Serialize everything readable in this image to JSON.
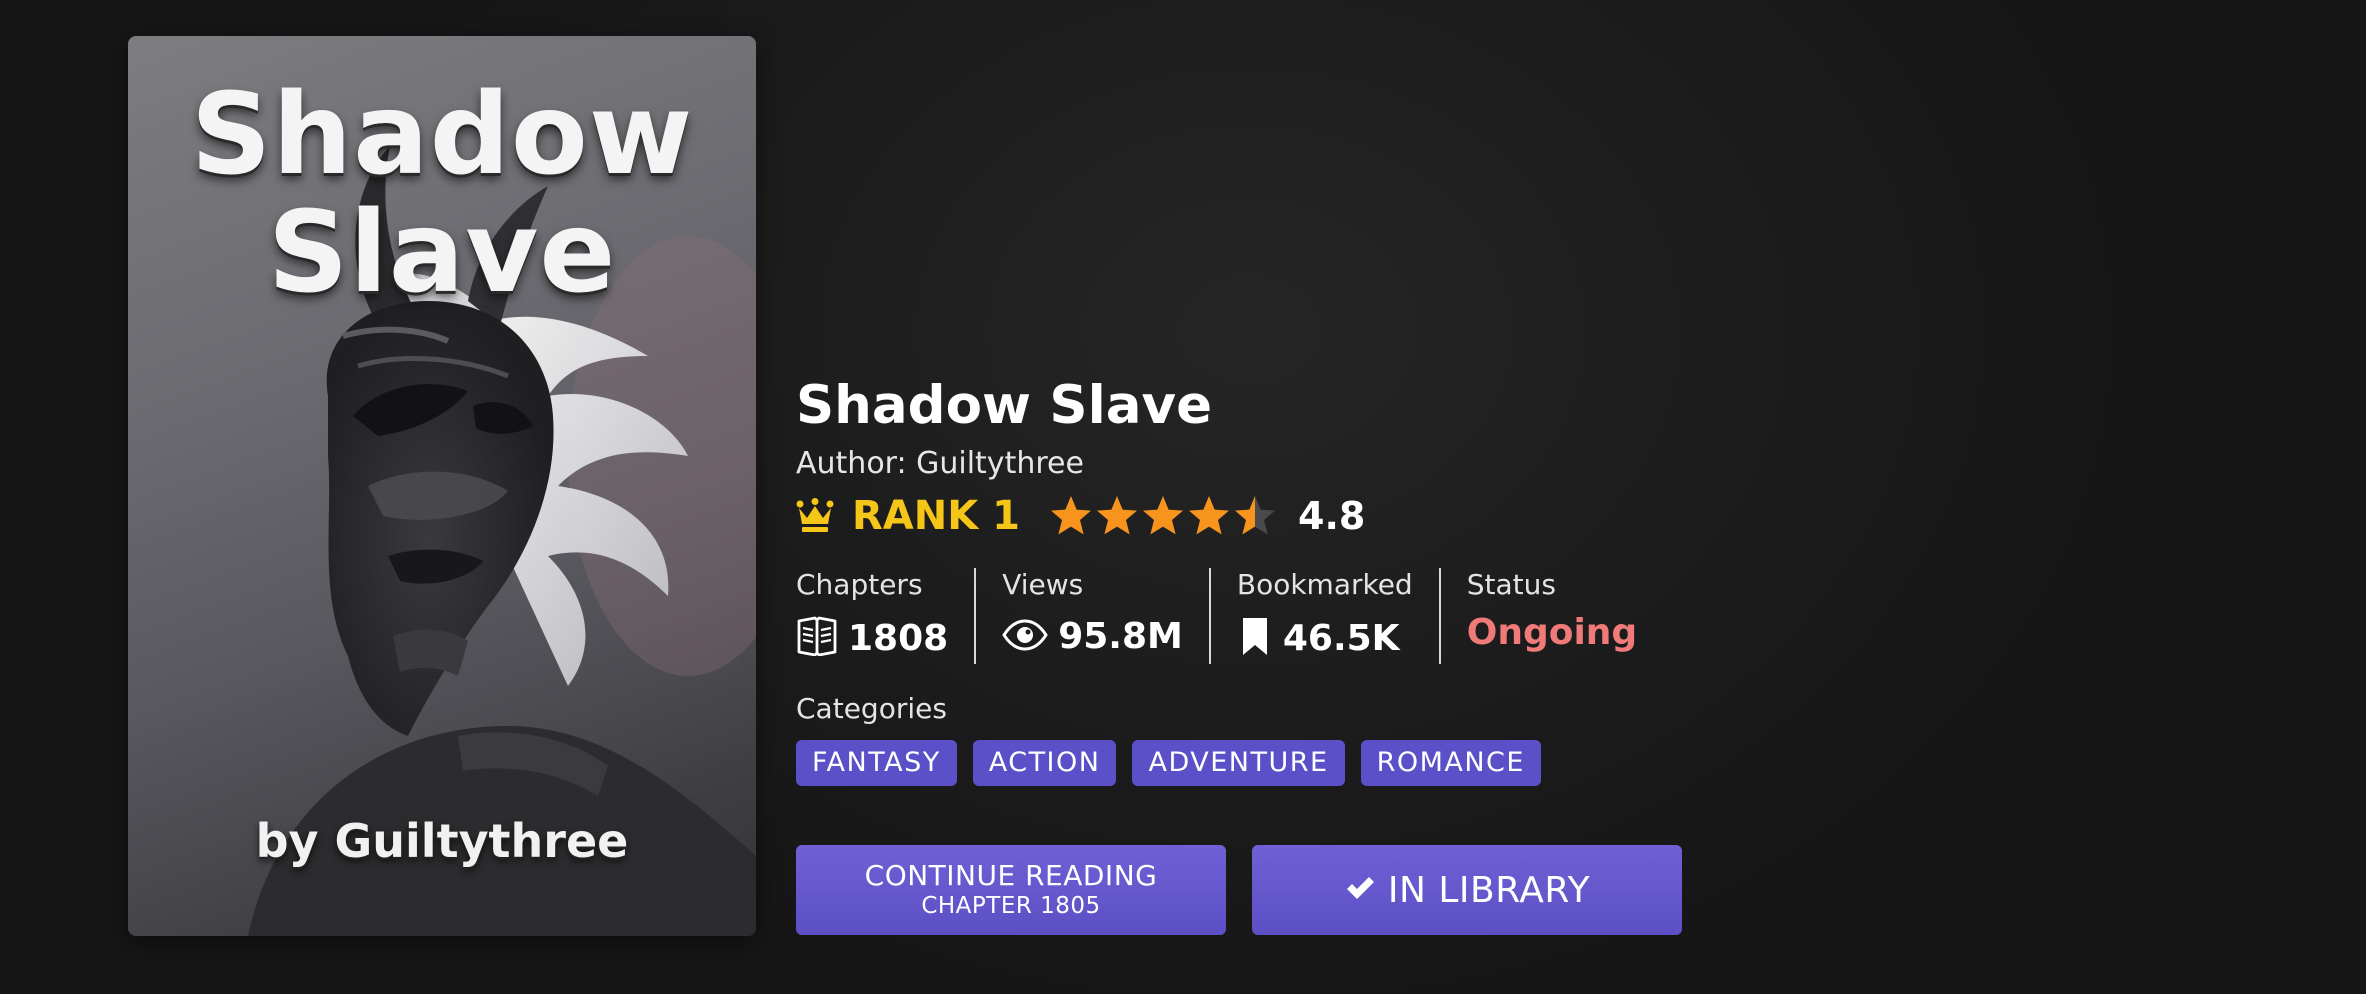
{
  "cover": {
    "title": "Shadow Slave",
    "byline": "by Guiltythree"
  },
  "novel": {
    "title": "Shadow Slave",
    "author": "Author: Guiltythree",
    "rank": "RANK 1",
    "rating": {
      "value": "4.8",
      "stars": 4.5,
      "max_stars": 5
    }
  },
  "stats": {
    "chapters": {
      "label": "Chapters",
      "value": "1808",
      "icon": "book-icon"
    },
    "views": {
      "label": "Views",
      "value": "95.8M",
      "icon": "eye-icon"
    },
    "bookmarked": {
      "label": "Bookmarked",
      "value": "46.5K",
      "icon": "bookmark-icon"
    },
    "status": {
      "label": "Status",
      "value": "Ongoing"
    }
  },
  "categories": {
    "label": "Categories",
    "tags": [
      "FANTASY",
      "ACTION",
      "ADVENTURE",
      "ROMANCE"
    ]
  },
  "actions": {
    "continue": {
      "line1": "CONTINUE READING",
      "line2": "CHAPTER 1805"
    },
    "library": {
      "label": "IN LIBRARY",
      "icon": "check-icon"
    }
  },
  "colors": {
    "rank": "#f5c518",
    "star": "#f7941d",
    "status": "#f07a78",
    "tag": "#5b50c8",
    "button": "#6657cf"
  }
}
